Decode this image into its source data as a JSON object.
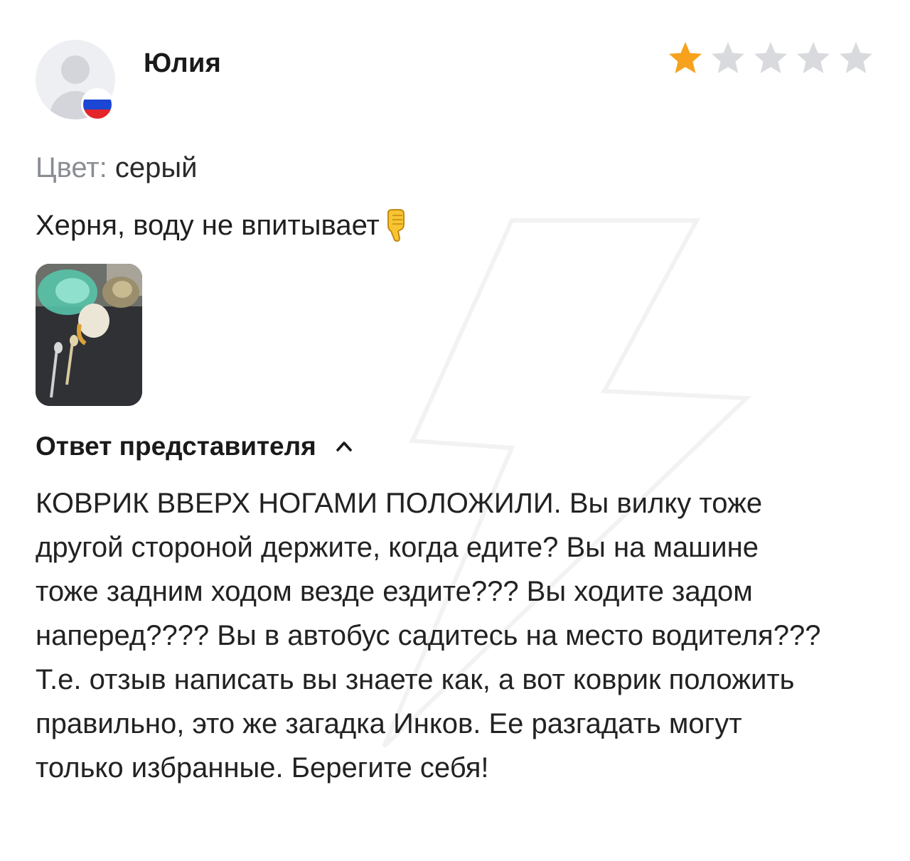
{
  "review": {
    "author": "Юлия",
    "rating": 1,
    "rating_max": 5,
    "colors": {
      "star_filled": "#f6a21c",
      "star_empty": "#d9dadd"
    },
    "avatar_icon": "user-placeholder-icon",
    "flag_icon": "russia-flag-icon",
    "variant_label": "Цвет:",
    "variant_value": "серый",
    "text": "Херня, воду не впитывает",
    "emoji_icon": "thumbs-down-icon"
  },
  "reply": {
    "title": "Ответ представителя",
    "toggle_icon": "chevron-up-icon",
    "text": "КОВРИК ВВЕРХ НОГАМИ ПОЛОЖИЛИ. Вы вилку тоже другой стороной держите, когда едите? Вы на машине тоже задним ходом везде ездите??? Вы ходите задом наперед???? Вы в автобус садитесь на место водителя??? Т.е. отзыв написать вы знаете как, а вот коврик положить правильно, это же загадка Инков. Ее разгадать могут только избранные. Берегите себя!"
  }
}
